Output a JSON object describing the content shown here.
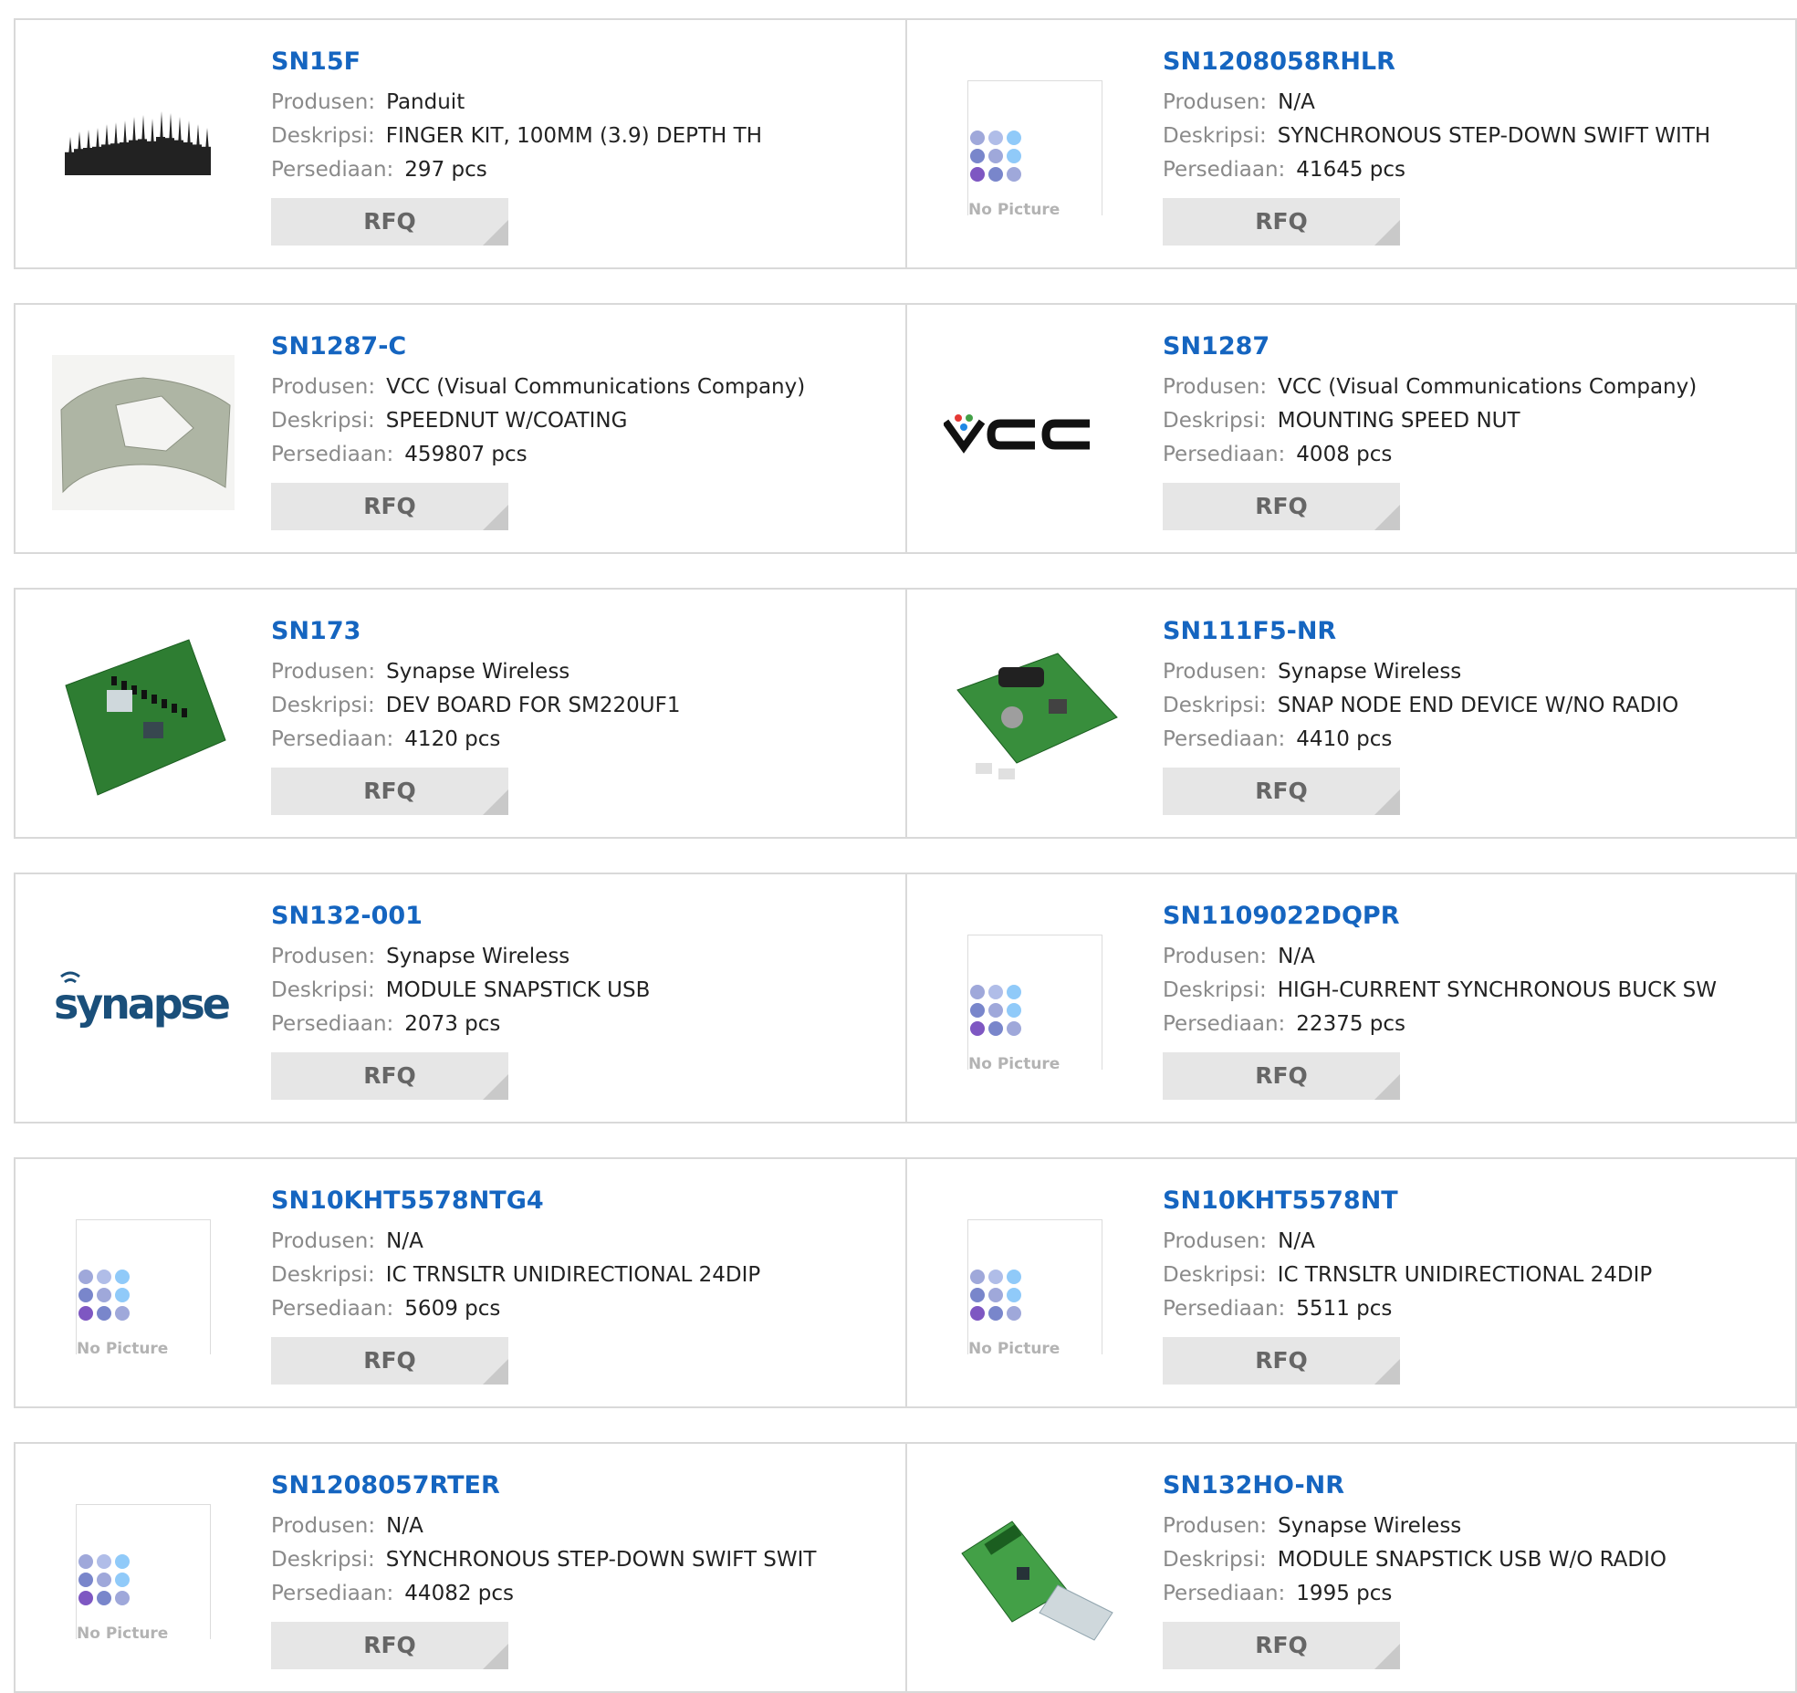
{
  "labels": {
    "manufacturer": "Produsen:",
    "description": "Deskripsi:",
    "stock": "Persediaan:",
    "rfq": "RFQ",
    "no_picture": "No Picture"
  },
  "colors": {
    "part_link": "#1565c0",
    "button_bg": "#e6e6e6",
    "label": "#8a8a8a"
  },
  "products": [
    {
      "part": "SN15F",
      "manufacturer": "Panduit",
      "description": "FINGER KIT, 100MM (3.9) DEPTH TH",
      "stock": "297 pcs",
      "image": "finger-kit"
    },
    {
      "part": "SN1208058RHLR",
      "manufacturer": "N/A",
      "description": "SYNCHRONOUS STEP-DOWN SWIFT WITH",
      "stock": "41645 pcs",
      "image": "no-picture"
    },
    {
      "part": "SN1287-C",
      "manufacturer": "VCC (Visual Communications Company)",
      "description": "SPEEDNUT W/COATING",
      "stock": "459807 pcs",
      "image": "speednut"
    },
    {
      "part": "SN1287",
      "manufacturer": "VCC (Visual Communications Company)",
      "description": "MOUNTING SPEED NUT",
      "stock": "4008 pcs",
      "image": "vcc-logo"
    },
    {
      "part": "SN173",
      "manufacturer": "Synapse Wireless",
      "description": "DEV BOARD FOR SM220UF1",
      "stock": "4120 pcs",
      "image": "dev-board"
    },
    {
      "part": "SN111F5-NR",
      "manufacturer": "Synapse Wireless",
      "description": "SNAP NODE END DEVICE W/NO RADIO",
      "stock": "4410 pcs",
      "image": "snap-node"
    },
    {
      "part": "SN132-001",
      "manufacturer": "Synapse Wireless",
      "description": "MODULE SNAPSTICK USB",
      "stock": "2073 pcs",
      "image": "synapse-logo"
    },
    {
      "part": "SN1109022DQPR",
      "manufacturer": "N/A",
      "description": "HIGH-CURRENT SYNCHRONOUS BUCK SW",
      "stock": "22375 pcs",
      "image": "no-picture"
    },
    {
      "part": "SN10KHT5578NTG4",
      "manufacturer": "N/A",
      "description": "IC TRNSLTR UNIDIRECTIONAL 24DIP",
      "stock": "5609 pcs",
      "image": "no-picture"
    },
    {
      "part": "SN10KHT5578NT",
      "manufacturer": "N/A",
      "description": "IC TRNSLTR UNIDIRECTIONAL 24DIP",
      "stock": "5511 pcs",
      "image": "no-picture"
    },
    {
      "part": "SN1208057RTER",
      "manufacturer": "N/A",
      "description": "SYNCHRONOUS STEP-DOWN SWIFT SWIT",
      "stock": "44082 pcs",
      "image": "no-picture"
    },
    {
      "part": "SN132HO-NR",
      "manufacturer": "Synapse Wireless",
      "description": "MODULE SNAPSTICK USB W/O RADIO",
      "stock": "1995 pcs",
      "image": "usb-stick"
    }
  ]
}
